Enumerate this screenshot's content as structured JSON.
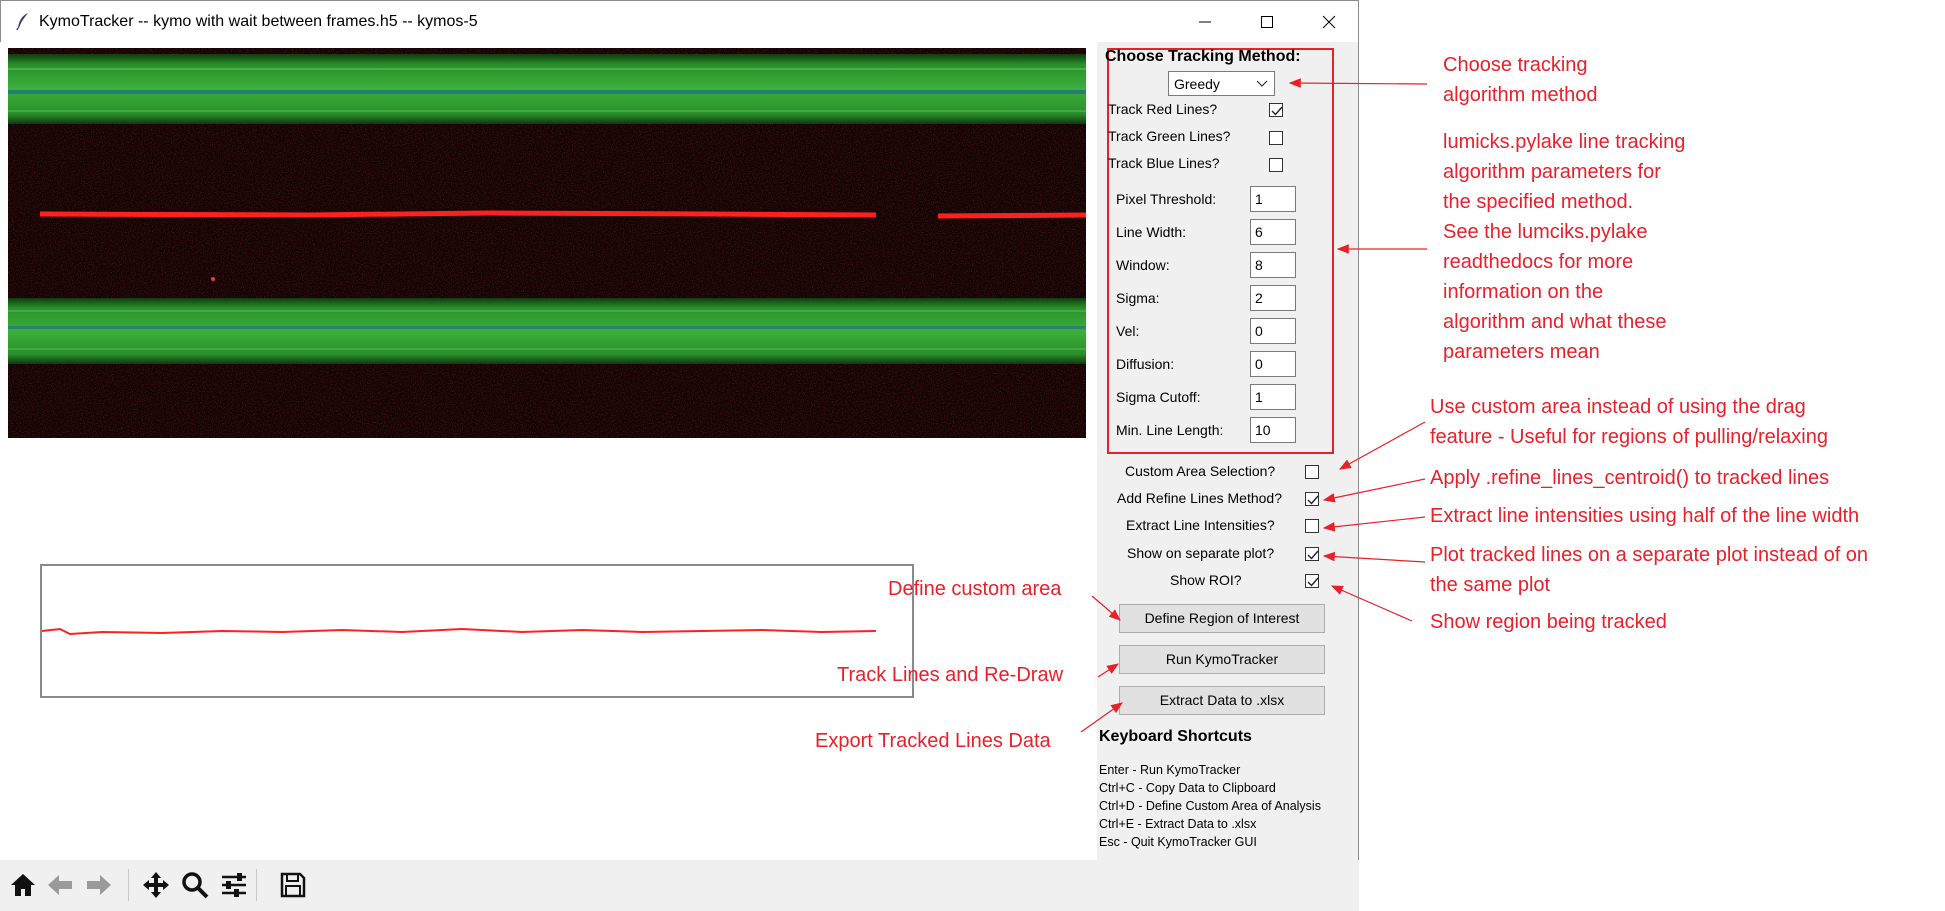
{
  "window": {
    "title": "KymoTracker -- kymo with wait between frames.h5 -- kymos-5",
    "controls": [
      "minimize",
      "maximize",
      "close"
    ]
  },
  "panel": {
    "method_heading": "Choose Tracking Method:",
    "method_value": "Greedy",
    "track_checks": [
      {
        "label": "Track Red Lines?",
        "checked": true
      },
      {
        "label": "Track Green Lines?",
        "checked": false
      },
      {
        "label": "Track Blue Lines?",
        "checked": false
      }
    ],
    "params": [
      {
        "label": "Pixel Threshold:",
        "value": "1"
      },
      {
        "label": "Line Width:",
        "value": "6"
      },
      {
        "label": "Window:",
        "value": "8"
      },
      {
        "label": "Sigma:",
        "value": "2"
      },
      {
        "label": "Vel:",
        "value": "0"
      },
      {
        "label": "Diffusion:",
        "value": "0"
      },
      {
        "label": "Sigma Cutoff:",
        "value": "1"
      },
      {
        "label": "Min. Line Length:",
        "value": "10"
      }
    ],
    "options": [
      {
        "label": "Custom Area Selection?",
        "checked": false
      },
      {
        "label": "Add Refine Lines Method?",
        "checked": true
      },
      {
        "label": "Extract Line Intensities?",
        "checked": false
      },
      {
        "label": "Show on separate plot?",
        "checked": true
      },
      {
        "label": "Show ROI?",
        "checked": true
      }
    ],
    "buttons": {
      "define_roi": "Define Region of Interest",
      "run": "Run KymoTracker",
      "extract": "Extract Data to .xlsx"
    },
    "shortcuts_heading": "Keyboard Shortcuts",
    "shortcuts": [
      "Enter - Run KymoTracker",
      "Ctrl+C - Copy Data to Clipboard",
      "Ctrl+D - Define Custom Area of Analysis",
      "Ctrl+E - Extract Data to .xlsx",
      "Esc - Quit KymoTracker GUI"
    ]
  },
  "toolbar": {
    "icons": [
      "home-icon",
      "back-arrow-icon",
      "forward-arrow-icon",
      "pan-icon",
      "zoom-icon",
      "configure-subplots-icon",
      "save-icon"
    ]
  },
  "annotations": {
    "choose_method": [
      "Choose tracking",
      "algorithm method"
    ],
    "params_info": [
      "lumicks.pylake line tracking",
      "algorithm parameters for",
      "the specified method.",
      "See the lumciks.pylake",
      "readthedocs for more",
      "information on the",
      "algorithm and what these",
      "parameters mean"
    ],
    "custom_area": [
      "Use custom area instead of using the drag",
      "feature - Useful for regions of pulling/relaxing"
    ],
    "refine": [
      "Apply .refine_lines_centroid() to tracked lines"
    ],
    "intensities": [
      "Extract line intensities using half of the line width"
    ],
    "separate_plot": [
      "Plot tracked lines on a separate plot instead of on",
      "the same plot"
    ],
    "show_roi": [
      "Show region being tracked"
    ],
    "define_custom": "Define custom area",
    "track_lines": "Track Lines and Re-Draw",
    "export": "Export Tracked Lines Data"
  },
  "colors": {
    "annotation_red": "#e8202a",
    "kymo_green": "#2fa82f",
    "kymo_red": "#ff2020",
    "kymo_background": "#120303"
  }
}
